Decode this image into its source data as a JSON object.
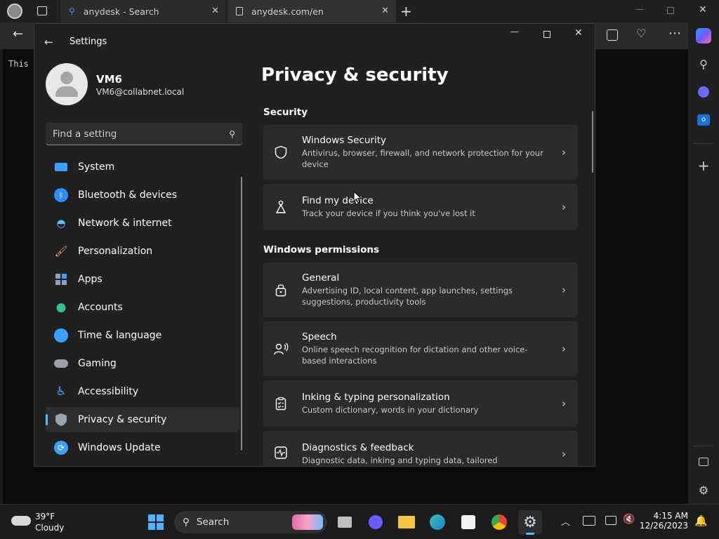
{
  "browser": {
    "tabs": [
      {
        "label": "anydesk - Search",
        "icon": "search-icon"
      },
      {
        "label": "anydesk.com/en",
        "icon": "page-icon"
      }
    ],
    "content_text": "This"
  },
  "settings": {
    "window_title": "Settings",
    "user": {
      "name": "VM6",
      "email": "VM6@collabnet.local"
    },
    "search_placeholder": "Find a setting",
    "nav": [
      {
        "label": "System",
        "icon": "monitor-icon",
        "color": "#3aa0ff"
      },
      {
        "label": "Bluetooth & devices",
        "icon": "bluetooth-icon",
        "color": "#2f8cff"
      },
      {
        "label": "Network & internet",
        "icon": "wifi-icon",
        "color": "#4cc2ff"
      },
      {
        "label": "Personalization",
        "icon": "brush-icon",
        "color": "#e8a35a"
      },
      {
        "label": "Apps",
        "icon": "apps-icon",
        "color": "#8aa3c2"
      },
      {
        "label": "Accounts",
        "icon": "person-icon",
        "color": "#2fc48d"
      },
      {
        "label": "Time & language",
        "icon": "globe-clock-icon",
        "color": "#3aa0ff"
      },
      {
        "label": "Gaming",
        "icon": "gamepad-icon",
        "color": "#9aa3ad"
      },
      {
        "label": "Accessibility",
        "icon": "accessibility-icon",
        "color": "#3aa0ff"
      },
      {
        "label": "Privacy & security",
        "icon": "shield-icon",
        "color": "#9aa3ad"
      },
      {
        "label": "Windows Update",
        "icon": "update-icon",
        "color": "#3aa0ff"
      }
    ],
    "selected": "Privacy & security",
    "page_title": "Privacy & security",
    "security_header": "Security",
    "permissions_header": "Windows permissions",
    "security_items": [
      {
        "title": "Windows Security",
        "desc": "Antivirus, browser, firewall, and network protection for your device",
        "icon": "shield-outline-icon"
      },
      {
        "title": "Find my device",
        "desc": "Track your device if you think you've lost it",
        "icon": "location-person-icon"
      }
    ],
    "permission_items": [
      {
        "title": "General",
        "desc": "Advertising ID, local content, app launches, settings suggestions, productivity tools",
        "icon": "lock-icon"
      },
      {
        "title": "Speech",
        "desc": "Online speech recognition for dictation and other voice-based interactions",
        "icon": "speech-icon"
      },
      {
        "title": "Inking & typing personalization",
        "desc": "Custom dictionary, words in your dictionary",
        "icon": "clipboard-check-icon"
      },
      {
        "title": "Diagnostics & feedback",
        "desc": "Diagnostic data, inking and typing data, tailored experiences,",
        "icon": "pulse-icon"
      }
    ]
  },
  "taskbar": {
    "weather": {
      "temp": "39°F",
      "condition": "Cloudy"
    },
    "search_label": "Search",
    "time": "4:15 AM",
    "date": "12/26/2023"
  }
}
